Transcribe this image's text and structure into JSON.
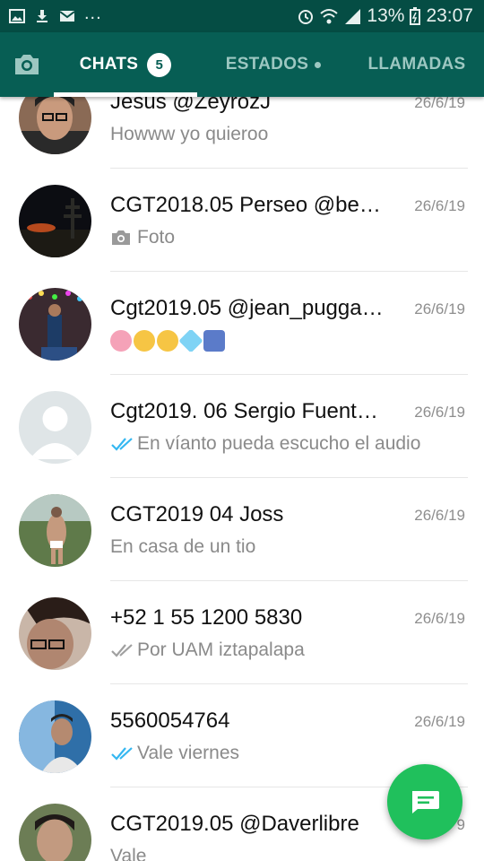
{
  "status_bar": {
    "left_icons": [
      "image-icon",
      "download-icon",
      "mail-icon"
    ],
    "more": "...",
    "battery": "13%",
    "time": "23:07"
  },
  "tabs": {
    "chats": {
      "label": "CHATS",
      "badge": "5"
    },
    "estados": {
      "label": "ESTADOS"
    },
    "llamadas": {
      "label": "LLAMADAS"
    }
  },
  "colors": {
    "header": "#075e54",
    "status_bar": "#054d44",
    "fab": "#20c05c",
    "read_tick": "#34b7f1"
  },
  "chats": [
    {
      "name": "Jesus @ZeyrozJ",
      "date": "26/6/19",
      "message": "Howww yo quieroo",
      "icon": ""
    },
    {
      "name": "CGT2018.05 Perseo @be…",
      "date": "26/6/19",
      "message": "Foto",
      "icon": "camera-icon"
    },
    {
      "name": "Cgt2019.05 @jean_pugga…",
      "date": "26/6/19",
      "message": "",
      "icon": "emoji-icons"
    },
    {
      "name": "Cgt2019. 06 Sergio Fuent…",
      "date": "26/6/19",
      "message": "En víanto pueda escucho el audio",
      "icon": "double-check-blue-icon"
    },
    {
      "name": "CGT2019 04 Joss",
      "date": "26/6/19",
      "message": "En casa de un tio",
      "icon": ""
    },
    {
      "name": "+52 1 55 1200 5830",
      "date": "26/6/19",
      "message": "Por UAM iztapalapa",
      "icon": "double-check-gray-icon"
    },
    {
      "name": "5560054764",
      "date": "26/6/19",
      "message": "Vale viernes",
      "icon": "double-check-blue-icon"
    },
    {
      "name": "CGT2019.05 @Daverlibre",
      "date": "9",
      "message": "Vale",
      "icon": ""
    }
  ],
  "fab": {
    "icon": "new-chat-icon"
  }
}
